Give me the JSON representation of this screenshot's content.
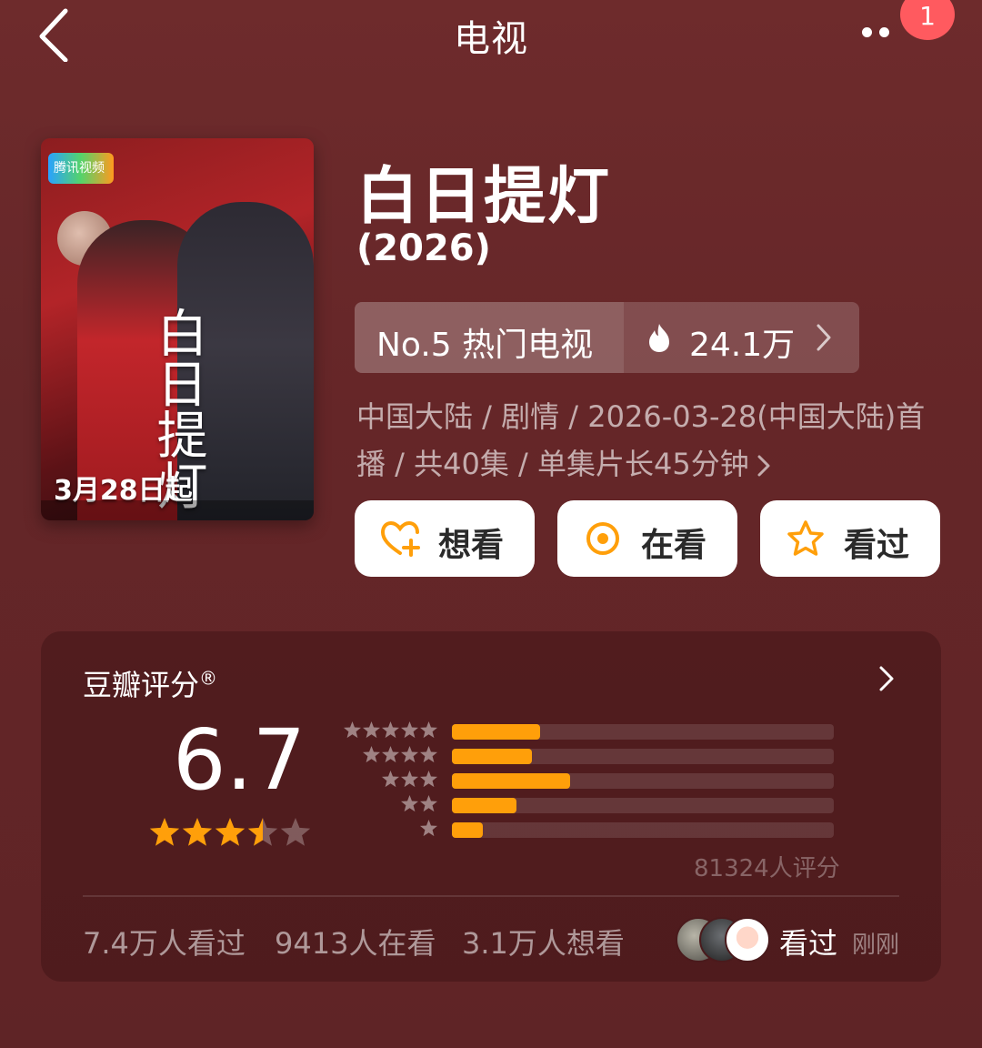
{
  "header": {
    "title": "电视",
    "notification_count": "1"
  },
  "poster": {
    "platform_label": "腾讯视频",
    "calligraphy_title": "白日提灯",
    "release_text": "3月28日起"
  },
  "show": {
    "title": "白日提灯",
    "year": "(2026)",
    "rank_label": "No.5 热门电视",
    "heat_value": "24.1万",
    "meta_text": "中国大陆 / 剧情 / 2026-03-28(中国大陆)首播 / 共40集 / 单集片长45分钟"
  },
  "actions": {
    "want": "想看",
    "watching": "在看",
    "watched": "看过"
  },
  "rating": {
    "title": "豆瓣评分",
    "registered": "®",
    "score": "6.7",
    "star_rating_out_of_5": 3.5,
    "rater_count": "81324人评分",
    "distribution": [
      {
        "stars": 5,
        "fraction": 0.23
      },
      {
        "stars": 4,
        "fraction": 0.21
      },
      {
        "stars": 3,
        "fraction": 0.31
      },
      {
        "stars": 2,
        "fraction": 0.17
      },
      {
        "stars": 1,
        "fraction": 0.08
      }
    ]
  },
  "stats": {
    "watched": "7.4万人看过",
    "watching": "9413人在看",
    "want": "3.1万人想看",
    "friend_status": "看过",
    "friend_time": "刚刚"
  },
  "colors": {
    "background": "#6a2a2b",
    "accent": "#ff9f0a",
    "badge": "#ff5a5f"
  }
}
